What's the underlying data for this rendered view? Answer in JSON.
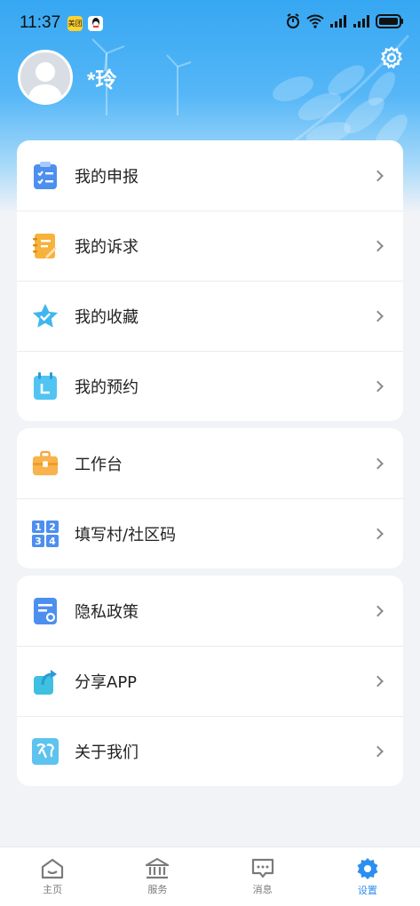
{
  "status_bar": {
    "time": "11:37",
    "app_badge_1": "美团",
    "icons": [
      "meituan-icon",
      "qq-icon",
      "alarm-icon",
      "wifi-icon",
      "signal-icon",
      "signal-icon",
      "battery-icon"
    ]
  },
  "profile": {
    "username": "*玲"
  },
  "menu_group_1": {
    "items": [
      {
        "label": "我的申报",
        "icon": "clipboard-checklist-icon"
      },
      {
        "label": "我的诉求",
        "icon": "notebook-pen-icon"
      },
      {
        "label": "我的收藏",
        "icon": "star-check-icon"
      },
      {
        "label": "我的预约",
        "icon": "calendar-icon"
      }
    ]
  },
  "menu_group_2": {
    "items": [
      {
        "label": "工作台",
        "icon": "briefcase-icon"
      },
      {
        "label": "填写村/社区码",
        "icon": "number-grid-icon"
      }
    ]
  },
  "menu_group_3": {
    "items": [
      {
        "label": "隐私政策",
        "icon": "policy-document-icon"
      },
      {
        "label": "分享APP",
        "icon": "share-arrow-icon"
      },
      {
        "label": "关于我们",
        "icon": "about-logo-icon"
      }
    ]
  },
  "tab_bar": {
    "tabs": [
      {
        "label": "主页",
        "icon": "home-icon",
        "active": false
      },
      {
        "label": "服务",
        "icon": "bank-icon",
        "active": false
      },
      {
        "label": "消息",
        "icon": "message-icon",
        "active": false
      },
      {
        "label": "设置",
        "icon": "gear-icon",
        "active": true
      }
    ]
  },
  "colors": {
    "accent": "#2b8ff0",
    "hero_top": "#36a7f2",
    "background": "#f2f3f7"
  }
}
